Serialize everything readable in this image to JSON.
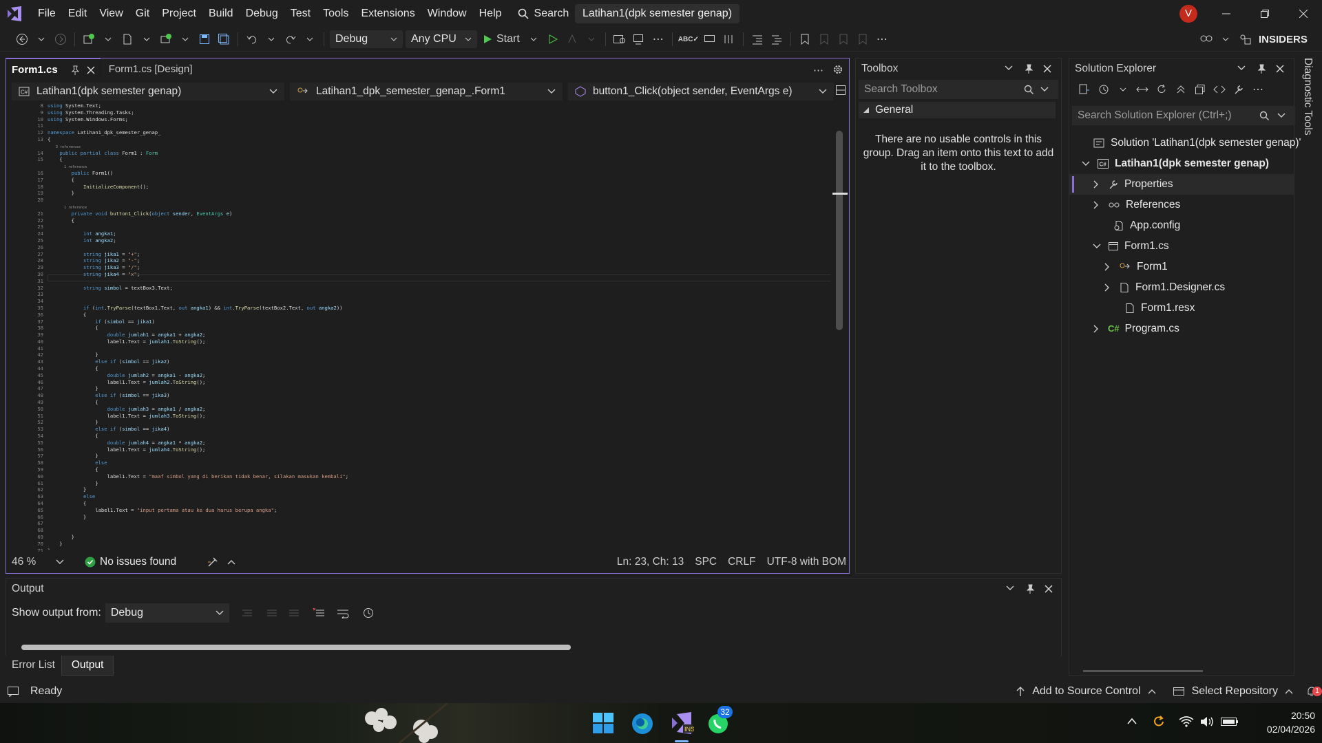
{
  "menu": {
    "items": [
      "File",
      "Edit",
      "View",
      "Git",
      "Project",
      "Build",
      "Debug",
      "Test",
      "Tools",
      "Extensions",
      "Window",
      "Help"
    ],
    "search_label": "Search",
    "solution_title": "Latihan1(dpk semester genap)",
    "avatar_letter": "V"
  },
  "toolbar": {
    "config": "Debug",
    "platform": "Any CPU",
    "start_label": "Start",
    "insiders_label": "INSIDERS"
  },
  "editor": {
    "tabs": [
      {
        "label": "Form1.cs",
        "active": true
      },
      {
        "label": "Form1.cs [Design]",
        "active": false
      }
    ],
    "nav": {
      "project": "Latihan1(dpk semester genap)",
      "class": "Latihan1_dpk_semester_genap_.Form1",
      "member": "button1_Click(object sender, EventArgs e)"
    },
    "code_lines": [
      {
        "n": "8",
        "t": "using System.Text;"
      },
      {
        "n": "9",
        "t": "using System.Threading.Tasks;"
      },
      {
        "n": "10",
        "t": "using System.Windows.Forms;"
      },
      {
        "n": "11",
        "t": ""
      },
      {
        "n": "12",
        "t": "namespace Latihan1_dpk_semester_genap_"
      },
      {
        "n": "13",
        "t": "{"
      },
      {
        "n": "",
        "t": "    3 references"
      },
      {
        "n": "14",
        "t": "    public partial class Form1 : Form"
      },
      {
        "n": "15",
        "t": "    {"
      },
      {
        "n": "",
        "t": "        1 reference"
      },
      {
        "n": "16",
        "t": "        public Form1()"
      },
      {
        "n": "17",
        "t": "        {"
      },
      {
        "n": "18",
        "t": "            InitializeComponent();"
      },
      {
        "n": "19",
        "t": "        }"
      },
      {
        "n": "20",
        "t": ""
      },
      {
        "n": "",
        "t": "        1 reference"
      },
      {
        "n": "21",
        "t": "        private void button1_Click(object sender, EventArgs e)"
      },
      {
        "n": "22",
        "t": "        {"
      },
      {
        "n": "23",
        "t": ""
      },
      {
        "n": "24",
        "t": "            int angka1;"
      },
      {
        "n": "25",
        "t": "            int angka2;"
      },
      {
        "n": "26",
        "t": ""
      },
      {
        "n": "27",
        "t": "            string jika1 = \"+\";"
      },
      {
        "n": "28",
        "t": "            string jika2 = \"-\";"
      },
      {
        "n": "29",
        "t": "            string jika3 = \"/\";"
      },
      {
        "n": "30",
        "t": "            string jika4 = \"x\";"
      },
      {
        "n": "31",
        "t": ""
      },
      {
        "n": "32",
        "t": "            string simbol = textBox3.Text;"
      },
      {
        "n": "33",
        "t": ""
      },
      {
        "n": "34",
        "t": ""
      },
      {
        "n": "35",
        "t": "            if (int.TryParse(textBox1.Text, out angka1) && int.TryParse(textBox2.Text, out angka2))"
      },
      {
        "n": "36",
        "t": "            {"
      },
      {
        "n": "37",
        "t": "                if (simbol == jika1)"
      },
      {
        "n": "38",
        "t": "                {"
      },
      {
        "n": "39",
        "t": "                    double jumlah1 = angka1 + angka2;"
      },
      {
        "n": "40",
        "t": "                    label1.Text = jumlah1.ToString();"
      },
      {
        "n": "41",
        "t": ""
      },
      {
        "n": "42",
        "t": "                }"
      },
      {
        "n": "43",
        "t": "                else if (simbol == jika2)"
      },
      {
        "n": "44",
        "t": "                {"
      },
      {
        "n": "45",
        "t": "                    double jumlah2 = angka1 - angka2;"
      },
      {
        "n": "46",
        "t": "                    label1.Text = jumlah2.ToString();"
      },
      {
        "n": "47",
        "t": "                }"
      },
      {
        "n": "48",
        "t": "                else if (simbol == jika3)"
      },
      {
        "n": "49",
        "t": "                {"
      },
      {
        "n": "50",
        "t": "                    double jumlah3 = angka1 / angka2;"
      },
      {
        "n": "51",
        "t": "                    label1.Text = jumlah3.ToString();"
      },
      {
        "n": "52",
        "t": "                }"
      },
      {
        "n": "53",
        "t": "                else if (simbol == jika4)"
      },
      {
        "n": "54",
        "t": "                {"
      },
      {
        "n": "55",
        "t": "                    double jumlah4 = angka1 * angka2;"
      },
      {
        "n": "56",
        "t": "                    label1.Text = jumlah4.ToString();"
      },
      {
        "n": "57",
        "t": "                }"
      },
      {
        "n": "58",
        "t": "                else"
      },
      {
        "n": "59",
        "t": "                {"
      },
      {
        "n": "60",
        "t": "                    label1.Text = \"maaf simbol yang di berikan tidak benar, silakan masukan kembali\";"
      },
      {
        "n": "61",
        "t": "                }"
      },
      {
        "n": "62",
        "t": "            }"
      },
      {
        "n": "63",
        "t": "            else"
      },
      {
        "n": "64",
        "t": "            {"
      },
      {
        "n": "65",
        "t": "                label1.Text = \"input pertama atau ke dua harus berupa angka\";"
      },
      {
        "n": "66",
        "t": "            }"
      },
      {
        "n": "67",
        "t": ""
      },
      {
        "n": "68",
        "t": ""
      },
      {
        "n": "69",
        "t": "        }"
      },
      {
        "n": "70",
        "t": "    }"
      },
      {
        "n": "71",
        "t": "}"
      }
    ],
    "status": {
      "zoom": "46 %",
      "issues": "No issues found",
      "position": "Ln: 23, Ch: 13",
      "whitespace": "SPC",
      "line_ending": "CRLF",
      "encoding": "UTF-8 with BOM"
    }
  },
  "toolbox": {
    "title": "Toolbox",
    "search_placeholder": "Search Toolbox",
    "group": "General",
    "empty_message": "There are no usable controls in this group. Drag an item onto this text to add it to the toolbox."
  },
  "solution_explorer": {
    "title": "Solution Explorer",
    "search_placeholder": "Search Solution Explorer (Ctrl+;)",
    "items": [
      {
        "label": "Solution 'Latihan1(dpk semester genap)'",
        "icon": "solution-icon"
      },
      {
        "label": "Latihan1(dpk semester genap)",
        "icon": "csharp-project-icon"
      },
      {
        "label": "Properties",
        "icon": "wrench-icon"
      },
      {
        "label": "References",
        "icon": "references-icon"
      },
      {
        "label": "App.config",
        "icon": "config-file-icon"
      },
      {
        "label": "Form1.cs",
        "icon": "form-icon"
      },
      {
        "label": "Form1",
        "icon": "class-icon"
      },
      {
        "label": "Form1.Designer.cs",
        "icon": "file-icon"
      },
      {
        "label": "Form1.resx",
        "icon": "file-icon"
      },
      {
        "label": "Program.cs",
        "icon": "csharp-file-icon"
      }
    ],
    "diagnostic_tab": "Diagnostic Tools"
  },
  "output": {
    "title": "Output",
    "show_from_label": "Show output from:",
    "source": "Debug",
    "tabs": [
      "Error List",
      "Output"
    ]
  },
  "statusbar": {
    "ready": "Ready",
    "source_control": "Add to Source Control",
    "repository": "Select Repository"
  },
  "taskbar": {
    "time": "20:50",
    "date": "02/04/2026",
    "whatsapp_badge": "32",
    "notification_badge": "1"
  },
  "colors": {
    "accent": "#8a6fd6",
    "background": "#1f1f1f",
    "editor_bg": "#1e1e1e",
    "start_green": "#4ec94e",
    "avatar": "#c42b1c"
  }
}
